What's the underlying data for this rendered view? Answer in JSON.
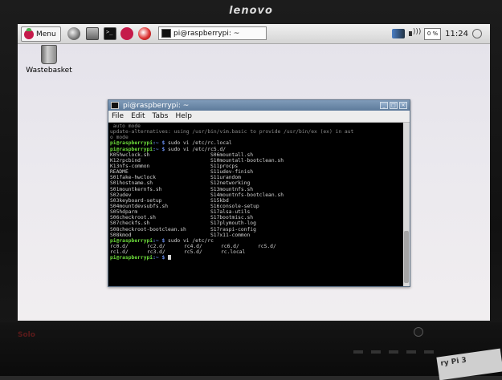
{
  "monitor": {
    "brand": "lenovo",
    "bottom_logo": "Solo",
    "sticker": "ry Pi 3"
  },
  "taskbar": {
    "menu_label": "Menu",
    "task_title": "pi@raspberrypi: ~",
    "cpu": "0 %",
    "clock": "11:24"
  },
  "desktop": {
    "wastebasket_label": "Wastebasket"
  },
  "terminal": {
    "title": "pi@raspberrypi: ~",
    "menu": [
      "File",
      "Edit",
      "Tabs",
      "Help"
    ],
    "prompt_user": "pi@raspberrypi",
    "prompt_path": ":~ $",
    "lines_top": [
      {
        "text": " auto mode",
        "dim": true
      },
      {
        "text": "update-alternatives: using /usr/bin/vim.basic to provide /usr/bin/ex (ex) in aut",
        "dim": true
      },
      {
        "text": "o mode",
        "dim": true
      }
    ],
    "cmd1": " sudo vi /etc/rc.local",
    "cmd2": " sudo vi /etc/rc5.d/",
    "listing": [
      [
        "K05hwclock.sh",
        "S06mountall.sh"
      ],
      [
        "K12rpcbind",
        "S10mountall-bootclean.sh"
      ],
      [
        "K13nfs-common",
        "S11procps"
      ],
      [
        "README",
        "S11udev-finish"
      ],
      [
        "S01fake-hwclock",
        "S11urandom"
      ],
      [
        "S01hostname.sh",
        "S12networking"
      ],
      [
        "S01mountkernfs.sh",
        "S13mountnfs.sh"
      ],
      [
        "S02udev",
        "S14mountnfs-bootclean.sh"
      ],
      [
        "S03keyboard-setup",
        "S15kbd"
      ],
      [
        "S04mountdevsubfs.sh",
        "S16console-setup"
      ],
      [
        "S05hdparm",
        "S17alsa-utils"
      ],
      [
        "S06checkroot.sh",
        "S17bootmisc.sh"
      ],
      [
        "S07checkfs.sh",
        "S17plymouth-log"
      ],
      [
        "S08checkroot-bootclean.sh",
        "S17raspi-config"
      ],
      [
        "S08kmod",
        "S17x11-common"
      ]
    ],
    "cmd3": " sudo vi /etc/rc",
    "rc_row1": [
      "rc0.d/",
      "rc2.d/",
      "rc4.d/",
      "rc6.d/",
      "rcS.d/"
    ],
    "rc_row2": [
      "rc1.d/",
      "rc3.d/",
      "rc5.d/",
      "rc.local",
      ""
    ],
    "cmd4": " "
  }
}
